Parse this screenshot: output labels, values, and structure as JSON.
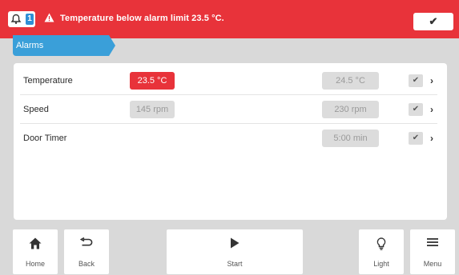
{
  "alarm_bar": {
    "count": "1",
    "message": "Temperature below alarm limit 23.5 °C.",
    "ack_label": "✔",
    "color": "#e8333a"
  },
  "tab": {
    "label": "Alarms",
    "color": "#3a9fd9"
  },
  "rows": [
    {
      "label": "Temperature",
      "actual": "23.5 °C",
      "limit": "24.5 °C",
      "check": "✔",
      "chevron": "›"
    },
    {
      "label": "Speed",
      "actual": "145 rpm",
      "limit": "230 rpm",
      "check": "✔",
      "chevron": "›"
    },
    {
      "label": "Door Timer",
      "limit": "5:00 min",
      "check": "✔",
      "chevron": "›"
    }
  ],
  "nav": {
    "home": "Home",
    "back": "Back",
    "start": "Start",
    "light": "Light",
    "menu": "Menu"
  },
  "icons": [
    "bell-icon",
    "warning-icon",
    "check-icon",
    "chevron-right-icon",
    "home-icon",
    "back-arrow-icon",
    "play-icon",
    "lightbulb-icon",
    "menu-icon"
  ]
}
